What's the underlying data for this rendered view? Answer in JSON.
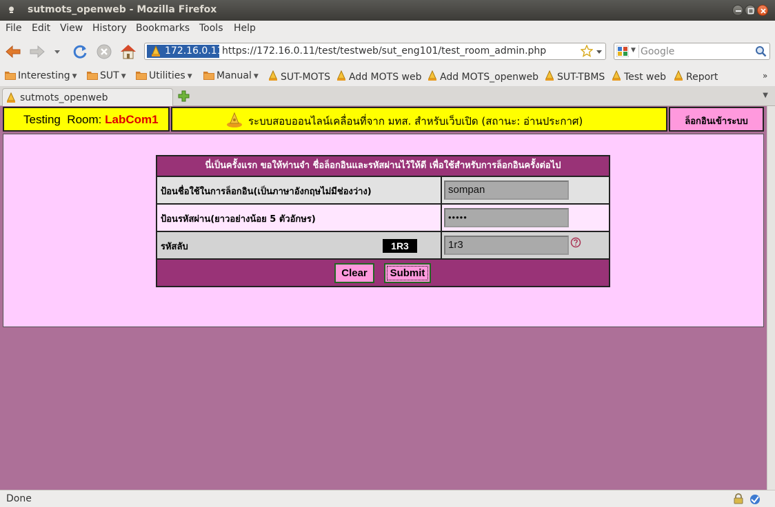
{
  "window": {
    "title": "sutmots_openweb - Mozilla Firefox"
  },
  "menu": [
    "File",
    "Edit",
    "View",
    "History",
    "Bookmarks",
    "Tools",
    "Help"
  ],
  "nav": {
    "identity": "172.16.0.11",
    "url": "https://172.16.0.11/test/testweb/sut_eng101/test_room_admin.php",
    "search_placeholder": "Google"
  },
  "bookmarks": [
    {
      "label": "Interesting",
      "icon": "folder-icon",
      "dropdown": true
    },
    {
      "label": "SUT",
      "icon": "folder-icon",
      "dropdown": true
    },
    {
      "label": "Utilities",
      "icon": "folder-icon",
      "dropdown": true
    },
    {
      "label": "Manual",
      "icon": "folder-icon",
      "dropdown": true
    },
    {
      "label": "SUT-MOTS",
      "icon": "lamp-icon",
      "dropdown": false
    },
    {
      "label": "Add MOTS web",
      "icon": "lamp-icon",
      "dropdown": false
    },
    {
      "label": "Add MOTS_openweb",
      "icon": "lamp-icon",
      "dropdown": false
    },
    {
      "label": "SUT-TBMS",
      "icon": "lamp-icon",
      "dropdown": false
    },
    {
      "label": "Test web",
      "icon": "lamp-icon",
      "dropdown": false
    },
    {
      "label": "Report",
      "icon": "lamp-icon",
      "dropdown": false
    }
  ],
  "tab": {
    "label": "sutmots_openweb"
  },
  "page": {
    "room_label": "Testing  Room:",
    "room_value": "LabCom1",
    "system_title": "ระบบสอบออนไลน์เคลื่อนที่จาก มทส. สำหรับเว็บเปิด (สถานะ: อ่านประกาศ)",
    "login_link": "ล็อกอินเข้าระบบ"
  },
  "form": {
    "heading": "นี่เป็นครั้งแรก ขอให้ท่านจำ ชื่อล็อกอินและรหัสผ่านไว้ให้ดี เพื่อใช้สำหรับการล็อกอินครั้งต่อไป",
    "username_label": "ป้อนชื่อใช้ในการล็อกอิน(เป็นภาษาอังกฤษไม่มีช่องว่าง)",
    "username_value": "sompan",
    "password_label": "ป้อนรหัสผ่าน(ยาวอย่างน้อย 5 ตัวอักษร)",
    "password_value": "•••••",
    "captcha_label": "รหัสลับ",
    "captcha_code": "1R3",
    "captcha_value": "1r3",
    "clear_button": "Clear",
    "submit_button": "Submit"
  },
  "status": {
    "text": "Done"
  }
}
